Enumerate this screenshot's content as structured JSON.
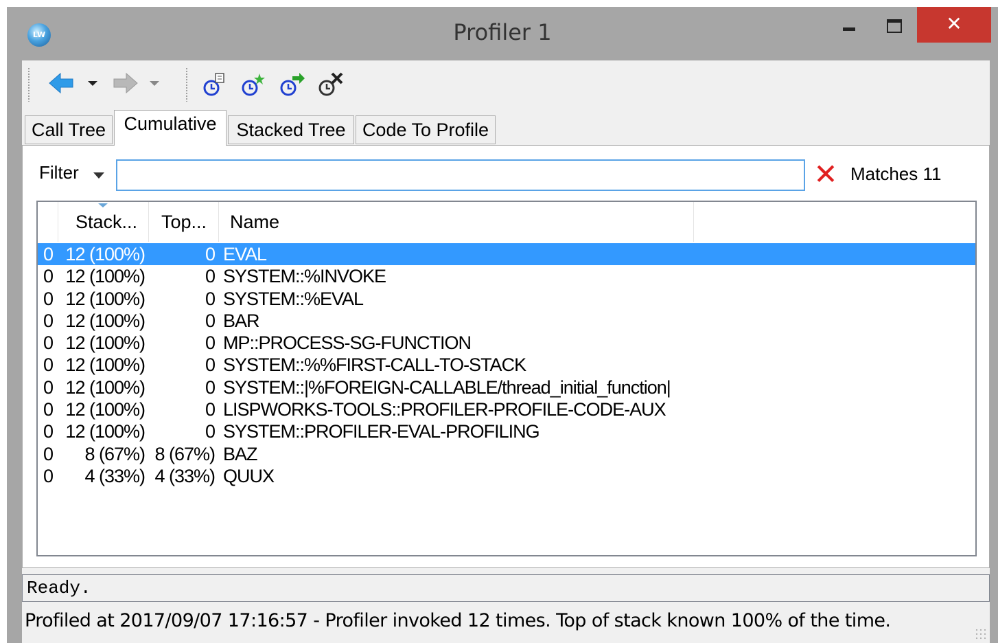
{
  "window": {
    "title": "Profiler 1",
    "app_icon_text": "LW",
    "close_glyph": "✕",
    "accent_close": "#c7372f"
  },
  "toolbar": {
    "back_icon": "back-arrow-icon",
    "forward_icon": "forward-arrow-icon",
    "icons": [
      "profile-view-icon",
      "profile-new-icon",
      "profile-run-icon",
      "profile-delete-icon"
    ]
  },
  "tabs": [
    {
      "label": "Call Tree",
      "active": false
    },
    {
      "label": "Cumulative",
      "active": true
    },
    {
      "label": "Stacked Tree",
      "active": false
    },
    {
      "label": "Code To Profile",
      "active": false
    }
  ],
  "filter": {
    "label": "Filter",
    "value": "",
    "clear_glyph": "✕",
    "matches": "Matches 11"
  },
  "list": {
    "columns": [
      "",
      "Stack...",
      "Top...",
      "Name"
    ],
    "selection_color": "#3399ff",
    "rows": [
      {
        "c0": "0",
        "stack": "12 (100%)",
        "top": "0",
        "name": "EVAL",
        "selected": true
      },
      {
        "c0": "0",
        "stack": "12 (100%)",
        "top": "0",
        "name": "SYSTEM::%INVOKE"
      },
      {
        "c0": "0",
        "stack": "12 (100%)",
        "top": "0",
        "name": "SYSTEM::%EVAL"
      },
      {
        "c0": "0",
        "stack": "12 (100%)",
        "top": "0",
        "name": "BAR"
      },
      {
        "c0": "0",
        "stack": "12 (100%)",
        "top": "0",
        "name": "MP::PROCESS-SG-FUNCTION"
      },
      {
        "c0": "0",
        "stack": "12 (100%)",
        "top": "0",
        "name": "SYSTEM::%%FIRST-CALL-TO-STACK"
      },
      {
        "c0": "0",
        "stack": "12 (100%)",
        "top": "0",
        "name": "SYSTEM::|%FOREIGN-CALLABLE/thread_initial_function|"
      },
      {
        "c0": "0",
        "stack": "12 (100%)",
        "top": "0",
        "name": "LISPWORKS-TOOLS::PROFILER-PROFILE-CODE-AUX"
      },
      {
        "c0": "0",
        "stack": "12 (100%)",
        "top": "0",
        "name": "SYSTEM::PROFILER-EVAL-PROFILING"
      },
      {
        "c0": "0",
        "stack": "8 (67%)",
        "top": "8 (67%)",
        "name": "BAZ"
      },
      {
        "c0": "0",
        "stack": "4 (33%)",
        "top": "4 (33%)",
        "name": "QUUX"
      }
    ]
  },
  "status": {
    "line1": "Ready.",
    "line2": "Profiled at 2017/09/07 17:16:57 - Profiler invoked 12 times. Top of stack known 100% of the time."
  }
}
